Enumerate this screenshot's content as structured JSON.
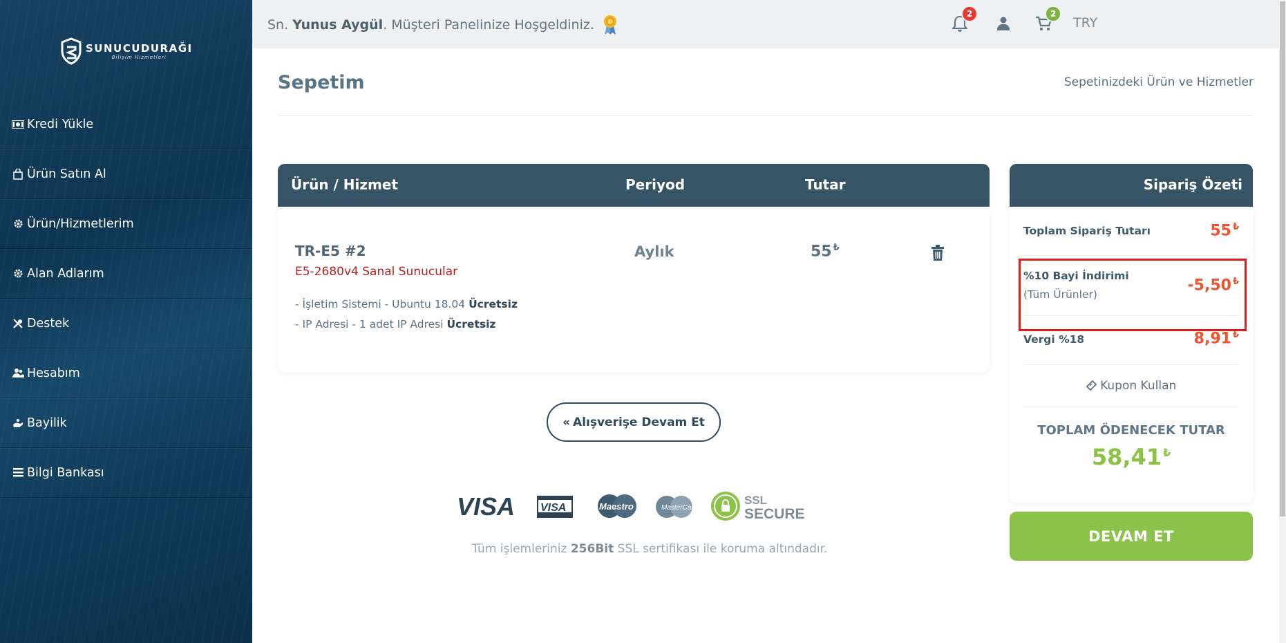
{
  "brand": {
    "name": "SUNUCUDURAĞI",
    "tagline": "Bilişim Hizmetleri"
  },
  "sidebar": {
    "items": [
      {
        "label": "Kredi Yükle",
        "icon": "money-icon"
      },
      {
        "label": "Ürün Satın Al",
        "icon": "shopping-bag-icon"
      },
      {
        "label": "Ürün/Hizmetlerim",
        "icon": "gear-icon"
      },
      {
        "label": "Alan Adlarım",
        "icon": "gear-icon"
      },
      {
        "label": "Destek",
        "icon": "tools-icon"
      },
      {
        "label": "Hesabım",
        "icon": "users-icon"
      },
      {
        "label": "Bayilik",
        "icon": "hand-icon"
      },
      {
        "label": "Bilgi Bankası",
        "icon": "list-icon"
      }
    ]
  },
  "topbar": {
    "welcome_prefix": "Sn.",
    "user_name": "Yunus Aygül",
    "welcome_suffix": ". Müşteri Panelinize Hoşgeldiniz.",
    "currency": "TRY",
    "notifications_count": "2",
    "cart_count": "2",
    "colors": {
      "notification_badge": "#e53935",
      "cart_badge": "#7cb342"
    }
  },
  "page": {
    "title": "Sepetim",
    "subtitle": "Sepetinizdeki Ürün ve Hizmetler"
  },
  "cart": {
    "headers": {
      "product": "Ürün / Hizmet",
      "period": "Periyod",
      "amount": "Tutar"
    },
    "item": {
      "name": "TR-E5 #2",
      "category": "E5-2680v4 Sanal Sunucular",
      "options": [
        {
          "text": "- İşletim Sistemi - Ubuntu 18.04",
          "price": "Ücretsiz"
        },
        {
          "text": "- IP Adresi - 1 adet IP Adresi",
          "price": "Ücretsiz"
        }
      ],
      "period": "Aylık",
      "amount": "55",
      "currency_symbol": "₺"
    },
    "continue_shopping": "Alışverişe Devam Et"
  },
  "security": {
    "note_prefix": "Tüm işlemleriniz",
    "note_bold": "256Bit",
    "note_suffix": "SSL sertifikası ile koruma altındadır.",
    "logos": [
      "VISA",
      "VISA ELECTRON",
      "Maestro",
      "MasterCard",
      "SSL SECURE"
    ]
  },
  "summary": {
    "title": "Sipariş Özeti",
    "order_total_label": "Toplam Sipariş Tutarı",
    "order_total": "55",
    "discount_label": "%10 Bayi İndirimi",
    "discount_sublabel": "(Tüm Ürünler)",
    "discount": "-5,50",
    "tax_label": "Vergi %18",
    "tax": "8,91",
    "coupon": "Kupon Kullan",
    "grand_total_label": "TOPLAM ÖDENECEK TUTAR",
    "grand_total": "58,41",
    "currency_symbol": "₺",
    "checkout": "DEVAM ET",
    "colors": {
      "accent": "#f0522c",
      "total": "#88c341",
      "header": "#375366"
    }
  }
}
